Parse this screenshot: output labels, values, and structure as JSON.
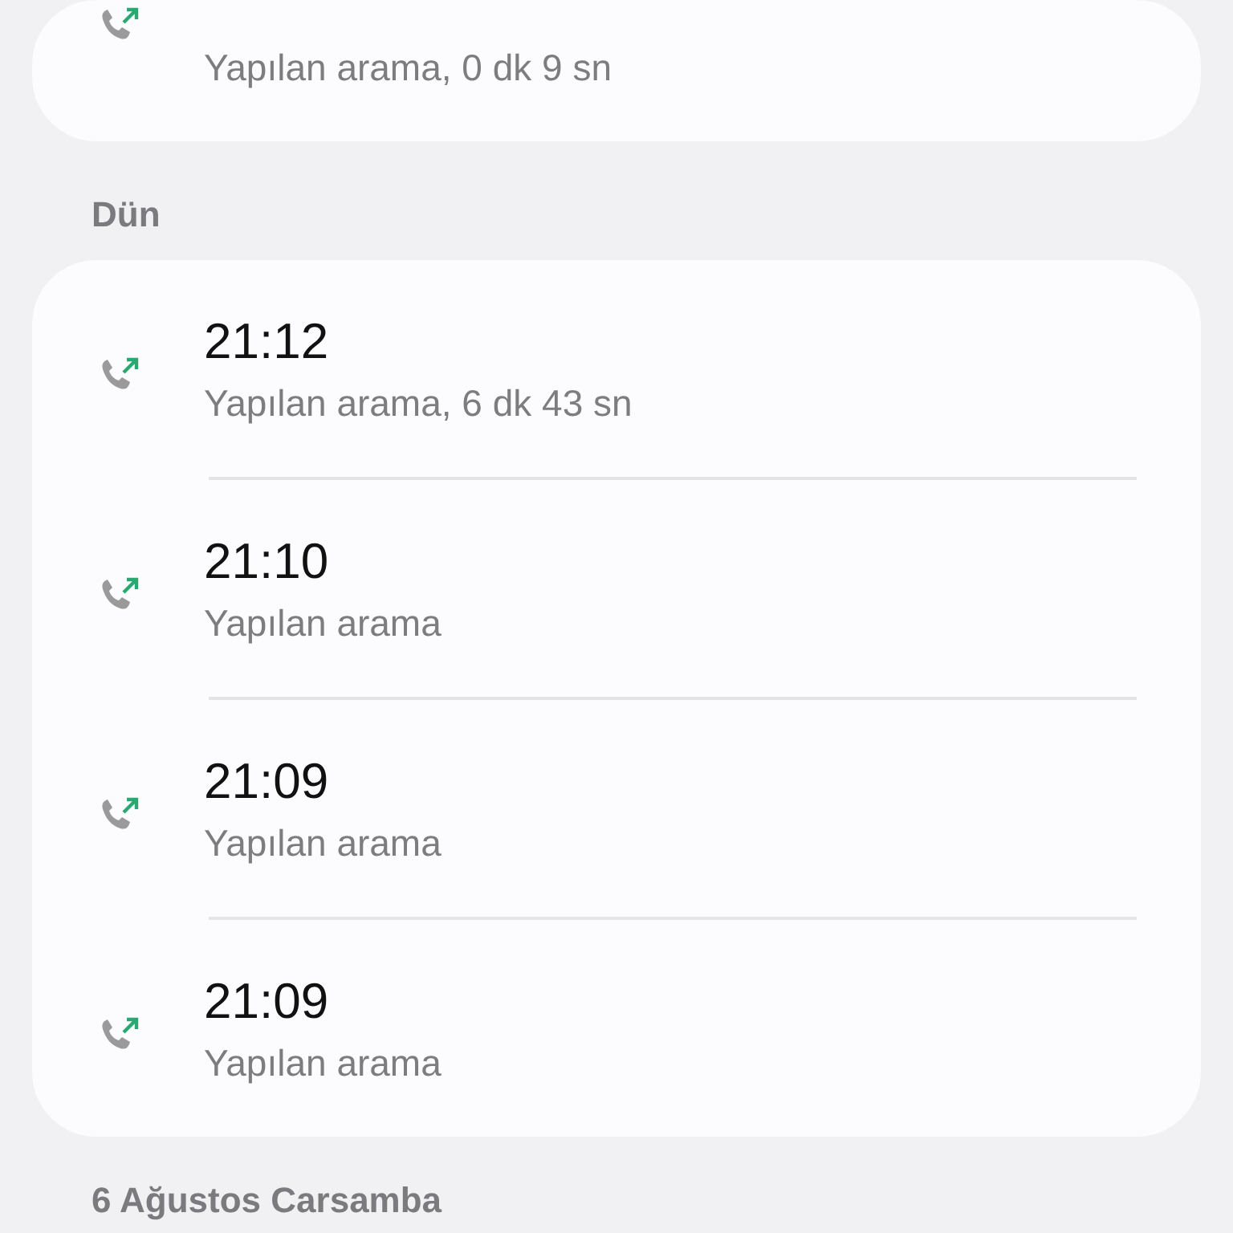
{
  "sections": [
    {
      "calls": [
        {
          "kind": "outgoing",
          "detail": "Yapılan arama, 0 dk 9 sn"
        }
      ]
    },
    {
      "header": "Dün",
      "calls": [
        {
          "kind": "outgoing",
          "time": "21:12",
          "detail": "Yapılan arama, 6 dk 43 sn"
        },
        {
          "kind": "outgoing",
          "time": "21:10",
          "detail": "Yapılan arama"
        },
        {
          "kind": "outgoing",
          "time": "21:09",
          "detail": "Yapılan arama"
        },
        {
          "kind": "outgoing",
          "time": "21:09",
          "detail": "Yapılan arama"
        }
      ]
    },
    {
      "header": "6 Ağustos Carsamba"
    }
  ]
}
